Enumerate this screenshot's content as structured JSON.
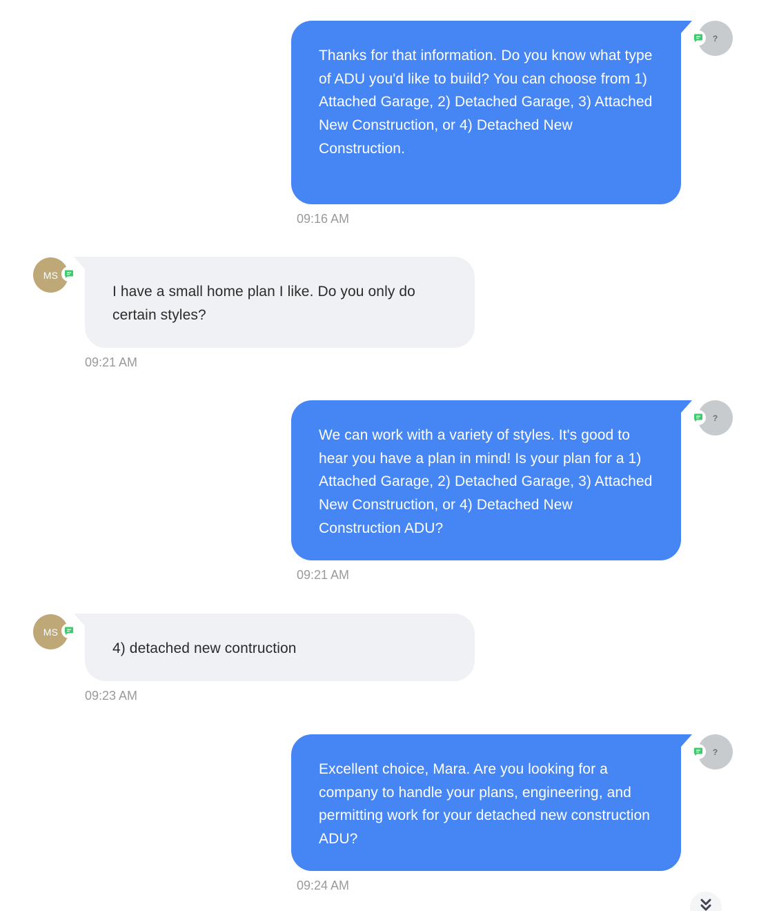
{
  "colors": {
    "outgoing_bubble": "#4585f4",
    "incoming_bubble": "#f0f1f5",
    "user_avatar": "#bfa878",
    "agent_avatar": "#c8cbce",
    "channel_icon": "#3ecb6b"
  },
  "messages": [
    {
      "direction": "outgoing",
      "avatar_initials": "?",
      "channel_icon": "chat-icon",
      "text": "Thanks for that information. Do you know what type of ADU you'd like to build? You can choose from 1) Attached Garage, 2) Detached Garage, 3) Attached New Construction, or 4) Detached New Construction.",
      "time": "09:16 AM"
    },
    {
      "direction": "incoming",
      "avatar_initials": "MS",
      "channel_icon": "chat-icon",
      "text": "I have a small home plan I like.  Do you only do certain styles?",
      "time": "09:21 AM"
    },
    {
      "direction": "outgoing",
      "avatar_initials": "?",
      "channel_icon": "chat-icon",
      "text": "We can work with a variety of styles. It's good to hear you have a plan in mind! Is your plan for a 1) Attached Garage, 2) Detached Garage, 3) Attached New Construction, or 4) Detached New Construction ADU?",
      "time": "09:21 AM"
    },
    {
      "direction": "incoming",
      "avatar_initials": "MS",
      "channel_icon": "chat-icon",
      "text": "4) detached new contruction",
      "time": "09:23 AM"
    },
    {
      "direction": "outgoing",
      "avatar_initials": "?",
      "channel_icon": "chat-icon",
      "text": "Excellent choice, Mara. Are you looking for a company to handle your plans, engineering, and permitting work for your detached new construction ADU?",
      "time": "09:24 AM"
    }
  ],
  "scroll_button": {
    "icon": "double-chevron-down-icon"
  }
}
